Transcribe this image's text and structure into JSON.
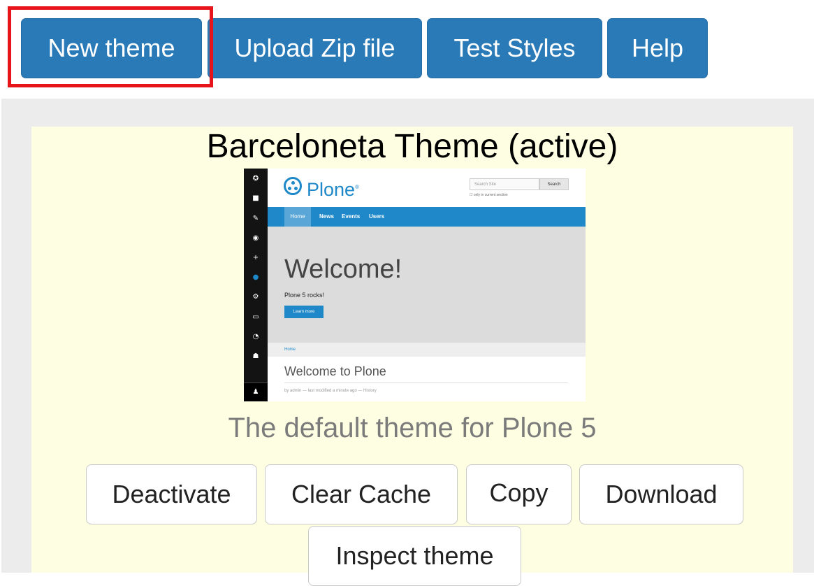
{
  "toolbar": {
    "new_theme": "New theme",
    "upload_zip": "Upload Zip file",
    "test_styles": "Test Styles",
    "help": "Help"
  },
  "theme": {
    "title": "Barceloneta Theme (active)",
    "description": "The default theme for Plone 5",
    "actions": {
      "deactivate": "Deactivate",
      "clear_cache": "Clear Cache",
      "copy": "Copy",
      "download": "Download",
      "inspect": "Inspect theme"
    }
  },
  "preview": {
    "logo": "Plone",
    "logo_mark": "®",
    "search_placeholder": "Search Site",
    "search_button": "Search",
    "search_option": "only in current section",
    "nav": [
      "Home",
      "News",
      "Events",
      "Users"
    ],
    "hero_title": "Welcome!",
    "hero_text": "Plone 5 rocks!",
    "hero_button": "Learn more",
    "breadcrumb": "Home",
    "page_title": "Welcome to Plone",
    "byline": "by admin — last modified a minute ago — History"
  },
  "colors": {
    "primary": "#2a7ab8",
    "highlight": "#e8141b",
    "card_bg": "#fefee2",
    "panel_bg": "#ececec",
    "plone_blue": "#1f88c9"
  }
}
